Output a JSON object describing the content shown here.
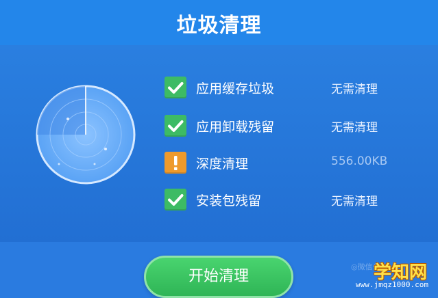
{
  "header": {
    "title": "垃圾清理"
  },
  "tasks": [
    {
      "label": "应用缓存垃圾",
      "status": "无需清理",
      "state": "ok",
      "icon": "checkmark-icon"
    },
    {
      "label": "应用卸载残留",
      "status": "无需清理",
      "state": "ok",
      "icon": "checkmark-icon"
    },
    {
      "label": "深度清理",
      "status": "556.00KB",
      "state": "warn",
      "icon": "exclamation-icon"
    },
    {
      "label": "安装包残留",
      "status": "无需清理",
      "state": "ok",
      "icon": "checkmark-icon"
    }
  ],
  "actions": {
    "start_label": "开始清理"
  },
  "watermark": {
    "logo": "学知网",
    "url": "www.jmqz1000.com",
    "faint": "◎微信公众"
  },
  "colors": {
    "background": "#1f74d6",
    "header": "#2386ea",
    "ok": "#3dbb64",
    "warn": "#ee9a2c",
    "button": "#3cc563"
  }
}
